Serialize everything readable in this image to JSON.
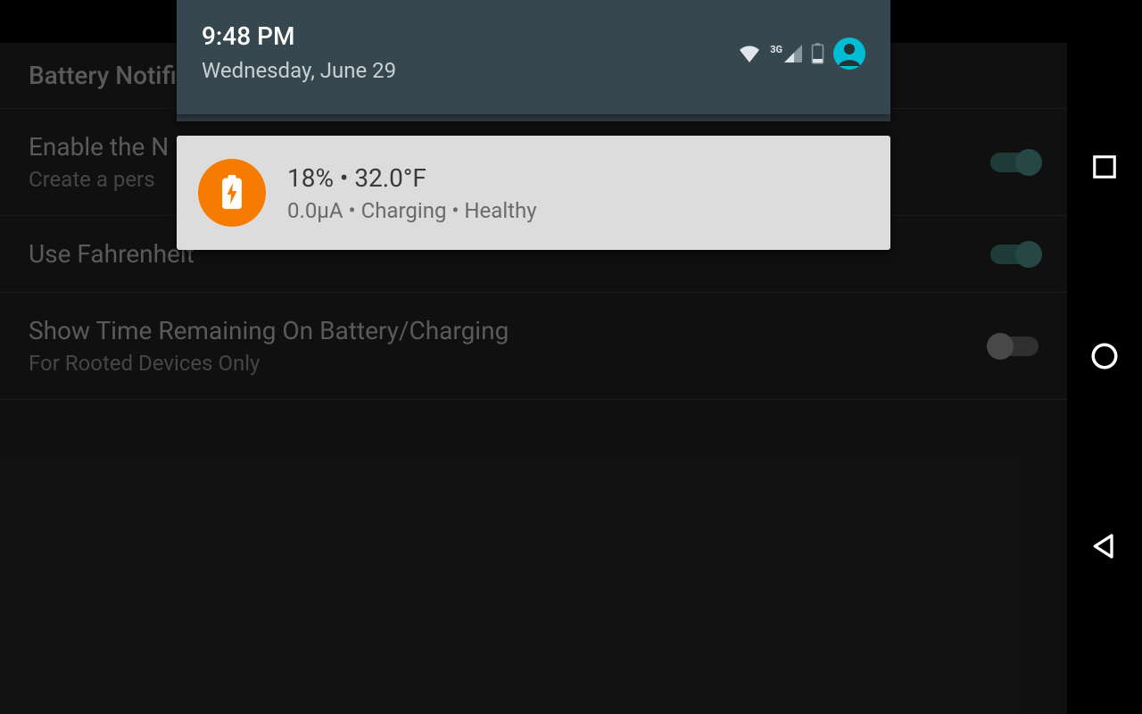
{
  "settings": {
    "header": "Battery Notifi",
    "rows": [
      {
        "title": "Enable the N",
        "subtitle": "Create a pers",
        "toggle": "on"
      },
      {
        "title": "Use Fahrenheit",
        "subtitle": "",
        "toggle": "on"
      },
      {
        "title": "Show Time Remaining On Battery/Charging",
        "subtitle": "For Rooted Devices Only",
        "toggle": "off"
      }
    ]
  },
  "shade": {
    "time": "9:48 PM",
    "date": "Wednesday, June 29",
    "status_icons": [
      "wifi",
      "3g-signal",
      "battery-charging",
      "user"
    ]
  },
  "notification": {
    "icon": "battery-charging",
    "primary": "18% • 32.0°F",
    "secondary": "0.0µA • Charging • Healthy",
    "accent_color": "#f57c00"
  },
  "nav": {
    "buttons": [
      "recent",
      "home",
      "back"
    ]
  }
}
